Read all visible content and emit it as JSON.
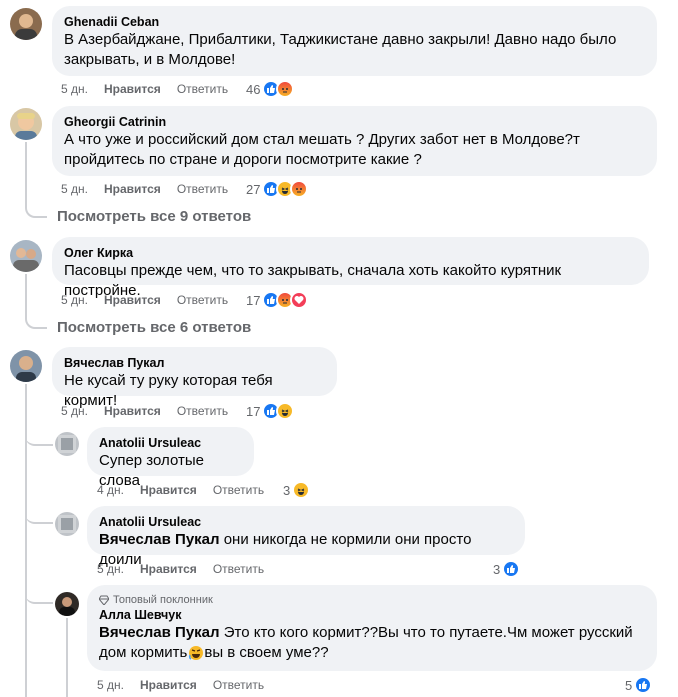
{
  "comments": [
    {
      "author": "Ghenadii Ceban",
      "text_line1": "В Азербайджане, Прибалтики, Таджикистане давно закрыли! Давно надо было",
      "text_line2": "закрывать, и в Молдове!",
      "time": "5 дн.",
      "like": "Нравится",
      "reply": "Ответить",
      "reaction_count": "46",
      "reactions": [
        "like",
        "angry"
      ]
    },
    {
      "author": "Gheorgii Catrinin",
      "text_line1": "А что уже и российский дом стал мешать ? Других забот нет в Молдове?т",
      "text_line2": "пройдитесь по стране и дороги посмотрите какие ?",
      "time": "5 дн.",
      "like": "Нравится",
      "reply": "Ответить",
      "reaction_count": "27",
      "reactions": [
        "like",
        "haha",
        "angry"
      ],
      "view_replies": "Посмотреть все 9 ответов"
    },
    {
      "author": "Олег Кирка",
      "text_line1": "Пасовцы прежде чем, что то закрывать, сначала хоть какойто курятник постройне.",
      "time": "5 дн.",
      "like": "Нравится",
      "reply": "Ответить",
      "reaction_count": "17",
      "reactions": [
        "like",
        "angry",
        "love"
      ],
      "view_replies": "Посмотреть все 6 ответов"
    },
    {
      "author": "Вячеслав Пукал",
      "text_line1": "Не кусай ту руку которая тебя кормит!",
      "time": "5 дн.",
      "like": "Нравится",
      "reply": "Ответить",
      "reaction_count": "17",
      "reactions": [
        "like",
        "haha"
      ]
    }
  ],
  "replies": [
    {
      "author": "Anatolii Ursuleac",
      "text_line1": "Супер золотые слова",
      "time": "4 дн.",
      "like": "Нравится",
      "reply": "Ответить",
      "reaction_count": "3",
      "reactions": [
        "haha"
      ]
    },
    {
      "author": "Anatolii Ursuleac",
      "mention": "Вячеслав Пукал",
      "text_line1": " они никогда не кормили они просто доили",
      "time": "5 дн.",
      "like": "Нравится",
      "reply": "Ответить",
      "reaction_count": "3",
      "reactions": [
        "like"
      ]
    },
    {
      "badge": "Топовый поклонник",
      "author": "Алла Шевчук",
      "mention": "Вячеслав Пукал",
      "text_line1": " Это кто кого кормит??Вы что то путаете.Чм может русский",
      "text_line2a": "дом кормить",
      "text_line2b": " вы в своем уме??",
      "time": "5 дн.",
      "like": "Нравится",
      "reply": "Ответить",
      "reaction_count": "5",
      "reactions": [
        "like"
      ]
    }
  ]
}
